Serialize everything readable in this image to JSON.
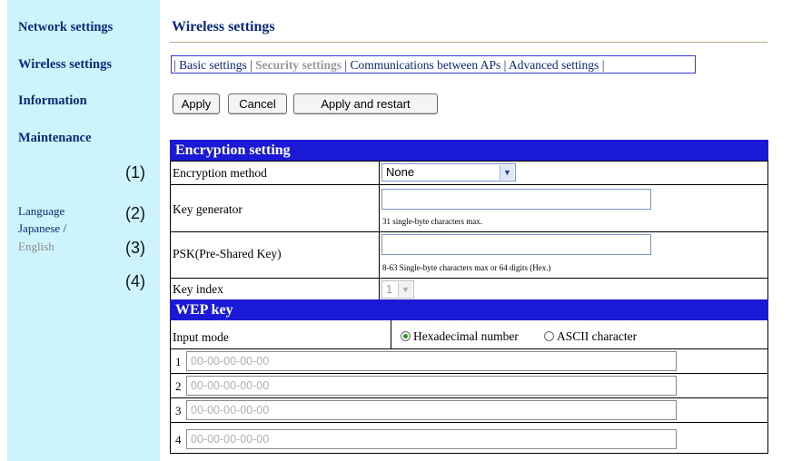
{
  "sidebar": {
    "items": [
      {
        "label": "Network settings"
      },
      {
        "label": "Wireless settings"
      },
      {
        "label": "Information"
      },
      {
        "label": "Maintenance"
      }
    ],
    "language_label": "Language",
    "japanese_label": "Japanese /",
    "english_label": "English"
  },
  "callouts": [
    "(1)",
    "(2)",
    "(3)",
    "(4)"
  ],
  "page_title": "Wireless settings",
  "tabs": [
    {
      "label": "Basic settings",
      "active": false
    },
    {
      "label": "Security settings",
      "active": true
    },
    {
      "label": "Communications between APs",
      "active": false
    },
    {
      "label": "Advanced settings",
      "active": false
    }
  ],
  "tab_separator": "|",
  "toolbar": {
    "apply": "Apply",
    "cancel": "Cancel",
    "apply_restart": "Apply and restart"
  },
  "encryption": {
    "header": "Encryption setting",
    "method_label": "Encryption method",
    "method_value": "None",
    "keygen_label": "Key generator",
    "keygen_hint": "31 single-byte characters max.",
    "psk_label": "PSK(Pre-Shared Key)",
    "psk_hint": "8-63 Single-byte characters max or 64 digits (Hex.)",
    "keyindex_label": "Key index",
    "keyindex_value": "1"
  },
  "wep": {
    "header": "WEP key",
    "input_mode_label": "Input mode",
    "mode_hex": "Hexadecimal number",
    "mode_ascii": "ASCII character",
    "selected_mode": "hex",
    "keys": [
      {
        "num": "1",
        "placeholder": "00-00-00-00-00"
      },
      {
        "num": "2",
        "placeholder": "00-00-00-00-00"
      },
      {
        "num": "3",
        "placeholder": "00-00-00-00-00"
      },
      {
        "num": "4",
        "placeholder": "00-00-00-00-00"
      }
    ]
  },
  "colors": {
    "header_bg": "#1a1ad6",
    "sidebar_bg": "#cdf4fb",
    "link": "#0a2a7c",
    "inactive": "#9a9a9a"
  }
}
